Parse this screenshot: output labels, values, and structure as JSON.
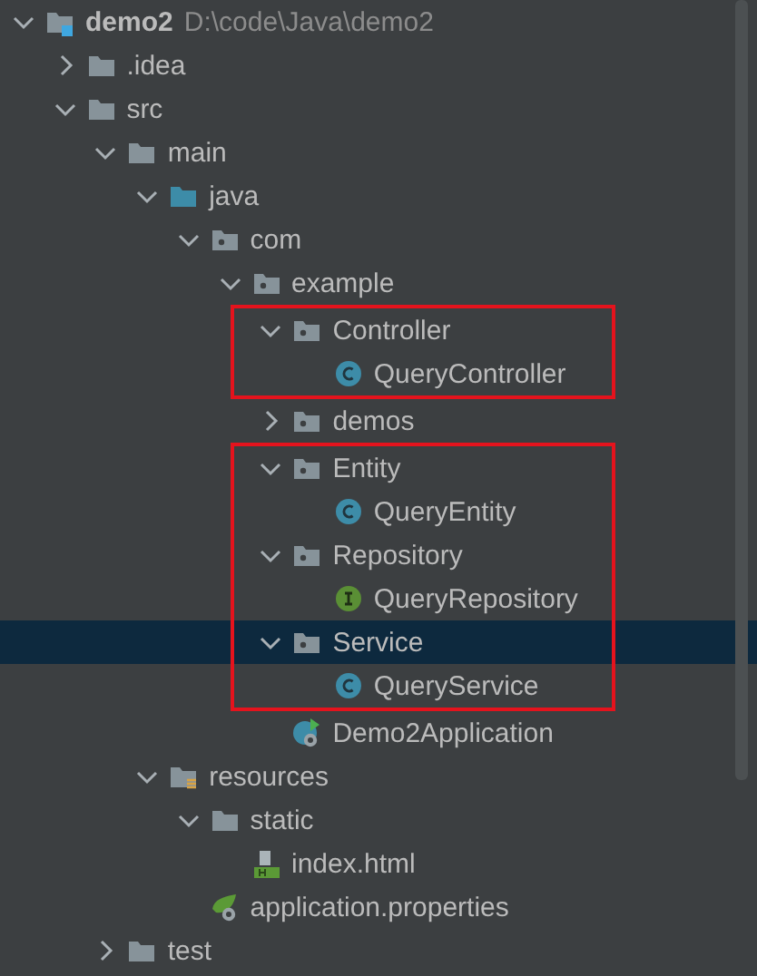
{
  "project_tree": [
    {
      "name": "demo2",
      "path": "D:\\code\\Java\\demo2",
      "kind": "module",
      "expanded": true,
      "selected": false,
      "annotated": false,
      "children": [
        {
          "name": ".idea",
          "kind": "folder",
          "expanded": false,
          "selected": false,
          "annotated": false
        },
        {
          "name": "src",
          "kind": "folder",
          "expanded": true,
          "selected": false,
          "annotated": false,
          "children": [
            {
              "name": "main",
              "kind": "folder",
              "expanded": true,
              "selected": false,
              "annotated": false,
              "children": [
                {
                  "name": "java",
                  "kind": "source",
                  "expanded": true,
                  "selected": false,
                  "annotated": false,
                  "children": [
                    {
                      "name": "com",
                      "kind": "package",
                      "expanded": true,
                      "selected": false,
                      "annotated": false,
                      "children": [
                        {
                          "name": "example",
                          "kind": "package",
                          "expanded": true,
                          "selected": false,
                          "annotated": false,
                          "children": [
                            {
                              "name": "Controller",
                              "kind": "package",
                              "expanded": true,
                              "selected": false,
                              "annotated": true,
                              "children": [
                                {
                                  "name": "QueryController",
                                  "kind": "class",
                                  "selected": false,
                                  "annotated": true
                                }
                              ]
                            },
                            {
                              "name": "demos",
                              "kind": "package",
                              "expanded": false,
                              "selected": false,
                              "annotated": false
                            },
                            {
                              "name": "Entity",
                              "kind": "package",
                              "expanded": true,
                              "selected": false,
                              "annotated": true,
                              "children": [
                                {
                                  "name": "QueryEntity",
                                  "kind": "class",
                                  "selected": false,
                                  "annotated": true
                                }
                              ]
                            },
                            {
                              "name": "Repository",
                              "kind": "package",
                              "expanded": true,
                              "selected": false,
                              "annotated": true,
                              "children": [
                                {
                                  "name": "QueryRepository",
                                  "kind": "interface",
                                  "selected": false,
                                  "annotated": true
                                }
                              ]
                            },
                            {
                              "name": "Service",
                              "kind": "package",
                              "expanded": true,
                              "selected": true,
                              "annotated": true,
                              "children": [
                                {
                                  "name": "QueryService",
                                  "kind": "class",
                                  "selected": false,
                                  "annotated": true
                                }
                              ]
                            },
                            {
                              "name": "Demo2Application",
                              "kind": "spring-app",
                              "selected": false,
                              "annotated": false
                            }
                          ]
                        }
                      ]
                    }
                  ]
                },
                {
                  "name": "resources",
                  "kind": "resources",
                  "expanded": true,
                  "selected": false,
                  "annotated": false,
                  "children": [
                    {
                      "name": "static",
                      "kind": "folder",
                      "expanded": true,
                      "selected": false,
                      "annotated": false,
                      "children": [
                        {
                          "name": "index.html",
                          "kind": "html",
                          "selected": false,
                          "annotated": false
                        }
                      ]
                    },
                    {
                      "name": "application.properties",
                      "kind": "spring-props",
                      "selected": false,
                      "annotated": false
                    }
                  ]
                }
              ]
            },
            {
              "name": "test",
              "kind": "folder",
              "expanded": false,
              "selected": false,
              "annotated": false
            }
          ]
        }
      ]
    }
  ]
}
